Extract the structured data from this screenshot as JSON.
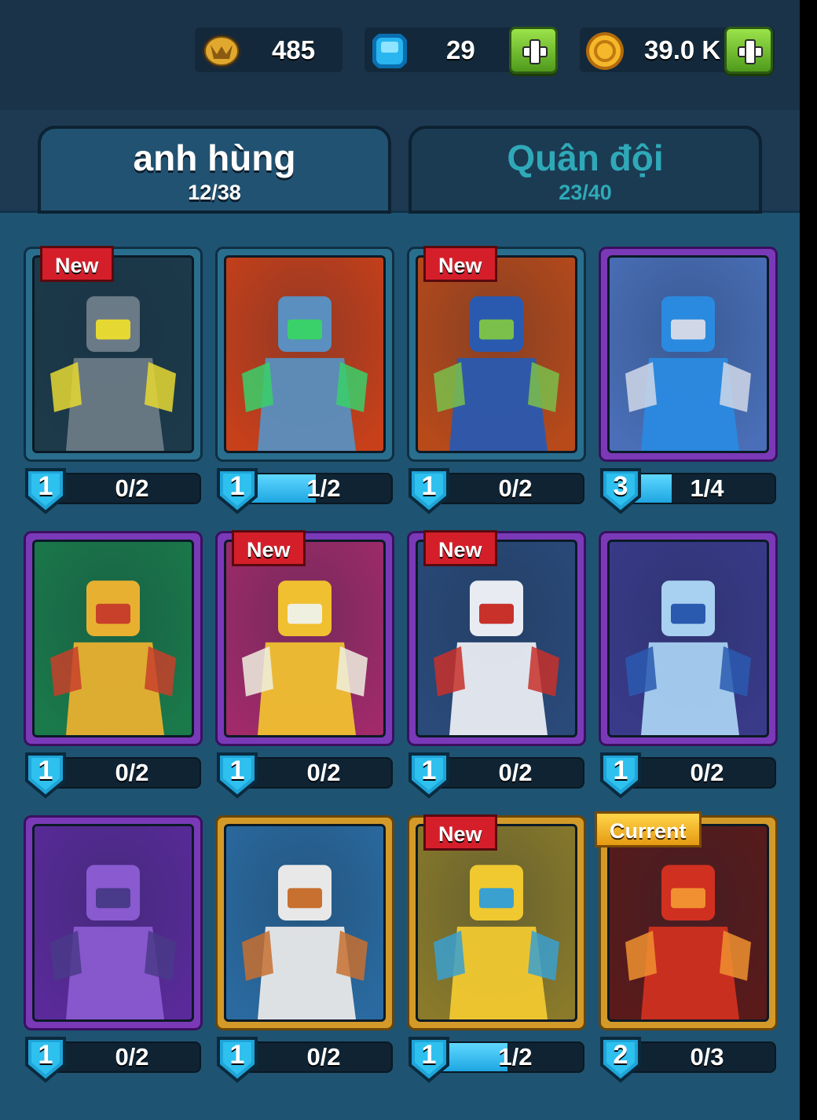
{
  "currency": {
    "trophies": "485",
    "gems": "29",
    "coins": "39.0 K",
    "trophy_icon": "trophy-emblem-icon",
    "gem_icon": "blue-gem-icon",
    "coin_icon": "gold-coin-icon"
  },
  "tabs": [
    {
      "label": "anh hùng",
      "count": "12/38",
      "active": true
    },
    {
      "label": "Quân đội",
      "count": "23/40",
      "active": false
    }
  ],
  "heroes": [
    {
      "badge": "New",
      "level": "1",
      "progress": "0/2",
      "fill": 0,
      "rarity": "blue",
      "art": "grey-robot-knight"
    },
    {
      "badge": "",
      "level": "1",
      "progress": "1/2",
      "fill": 0.5,
      "rarity": "blue",
      "art": "cannon-robot"
    },
    {
      "badge": "New",
      "level": "1",
      "progress": "0/2",
      "fill": 0,
      "rarity": "blue",
      "art": "blue-ninja-dual-blades"
    },
    {
      "badge": "",
      "level": "3",
      "progress": "1/4",
      "fill": 0.25,
      "rarity": "purple",
      "art": "skull-shield-knight"
    },
    {
      "badge": "",
      "level": "1",
      "progress": "0/2",
      "fill": 0,
      "rarity": "purple",
      "art": "hooded-scholar"
    },
    {
      "badge": "New",
      "level": "1",
      "progress": "0/2",
      "fill": 0,
      "rarity": "purple",
      "art": "golden-king-priest"
    },
    {
      "badge": "New",
      "level": "1",
      "progress": "0/2",
      "fill": 0,
      "rarity": "purple",
      "art": "santa-brawler"
    },
    {
      "badge": "",
      "level": "1",
      "progress": "0/2",
      "fill": 0,
      "rarity": "purple",
      "art": "ice-skeleton-king"
    },
    {
      "badge": "",
      "level": "1",
      "progress": "0/2",
      "fill": 0,
      "rarity": "purple",
      "art": "purple-crystal-witch"
    },
    {
      "badge": "",
      "level": "1",
      "progress": "0/2",
      "fill": 0,
      "rarity": "gold",
      "art": "white-bearded-sage"
    },
    {
      "badge": "New",
      "level": "1",
      "progress": "1/2",
      "fill": 0.5,
      "rarity": "gold",
      "art": "golden-clock-guardian"
    },
    {
      "badge": "Current",
      "level": "2",
      "progress": "0/3",
      "fill": 0,
      "rarity": "gold",
      "art": "red-fire-demon"
    }
  ]
}
